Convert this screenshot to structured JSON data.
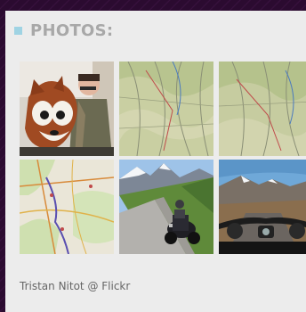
{
  "widget": {
    "title": "PHOTOS:",
    "credit": "Tristan Nitot @ Flickr"
  },
  "photos": [
    {
      "subject": "person-with-fox-mascot"
    },
    {
      "subject": "topographic-map"
    },
    {
      "subject": "topographic-map"
    },
    {
      "subject": "road-map"
    },
    {
      "subject": "motorcycle-mountain-road"
    },
    {
      "subject": "motorcycle-handlebar-view"
    }
  ],
  "colors": {
    "background": "#2a0a2e",
    "panel": "#ececec",
    "accent_square": "#9fd3e3",
    "title_text": "#a8a8a8",
    "credit_text": "#666666"
  }
}
